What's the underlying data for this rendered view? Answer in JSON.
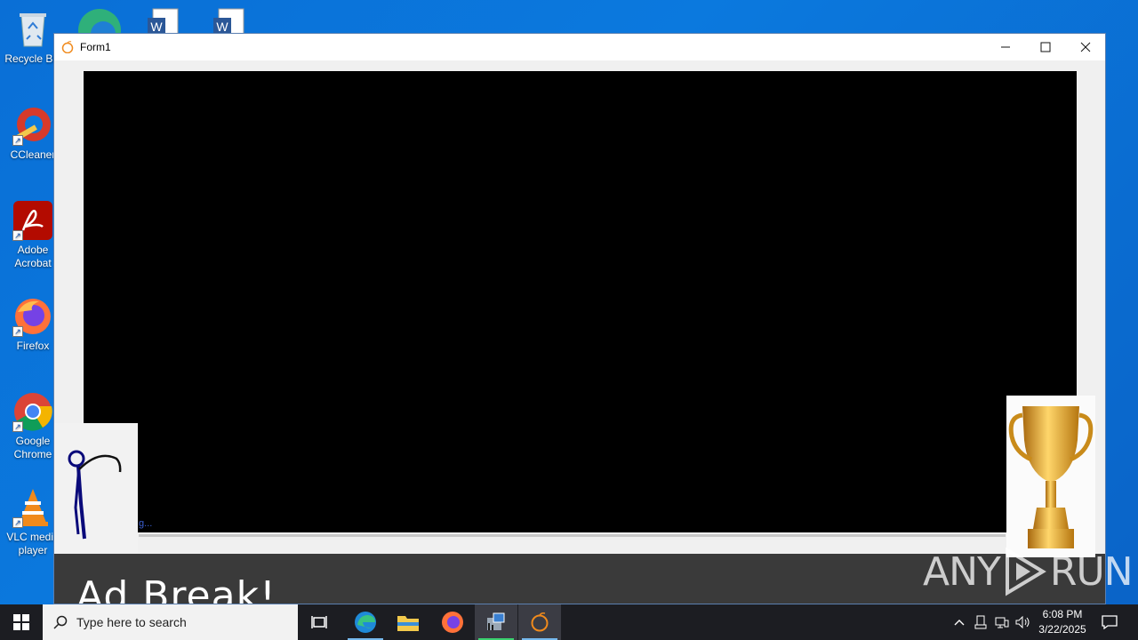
{
  "desktop": {
    "icons": [
      {
        "label": "Recycle Bin",
        "icon": "recycle-bin-icon"
      },
      {
        "label": "CCleaner",
        "icon": "ccleaner-icon"
      },
      {
        "label": "Adobe Acrobat",
        "icon": "adobe-acrobat-icon"
      },
      {
        "label": "Firefox",
        "icon": "firefox-icon"
      },
      {
        "label": "Google Chrome",
        "icon": "chrome-icon"
      },
      {
        "label": "VLC media player",
        "icon": "vlc-icon"
      }
    ],
    "top_icons": [
      "edge-icon",
      "word-document-icon",
      "word-document-icon"
    ]
  },
  "window": {
    "title": "Form1",
    "loading_text": "g...",
    "ad_text": "Ad Break!",
    "controls": [
      "minimize",
      "maximize",
      "close"
    ]
  },
  "watermark": {
    "text_left": "ANY",
    "text_right": "RUN"
  },
  "taskbar": {
    "search_placeholder": "Type here to search",
    "apps": [
      "task-view-icon",
      "edge-icon",
      "file-explorer-icon",
      "firefox-icon",
      "network-tool-icon",
      "form1-app-icon"
    ],
    "time": "6:08 PM",
    "date": "3/22/2025"
  },
  "colors": {
    "desktop_bg": "#0b79de",
    "taskbar_bg": "#1c1d22",
    "accent": "#76b9ed"
  }
}
